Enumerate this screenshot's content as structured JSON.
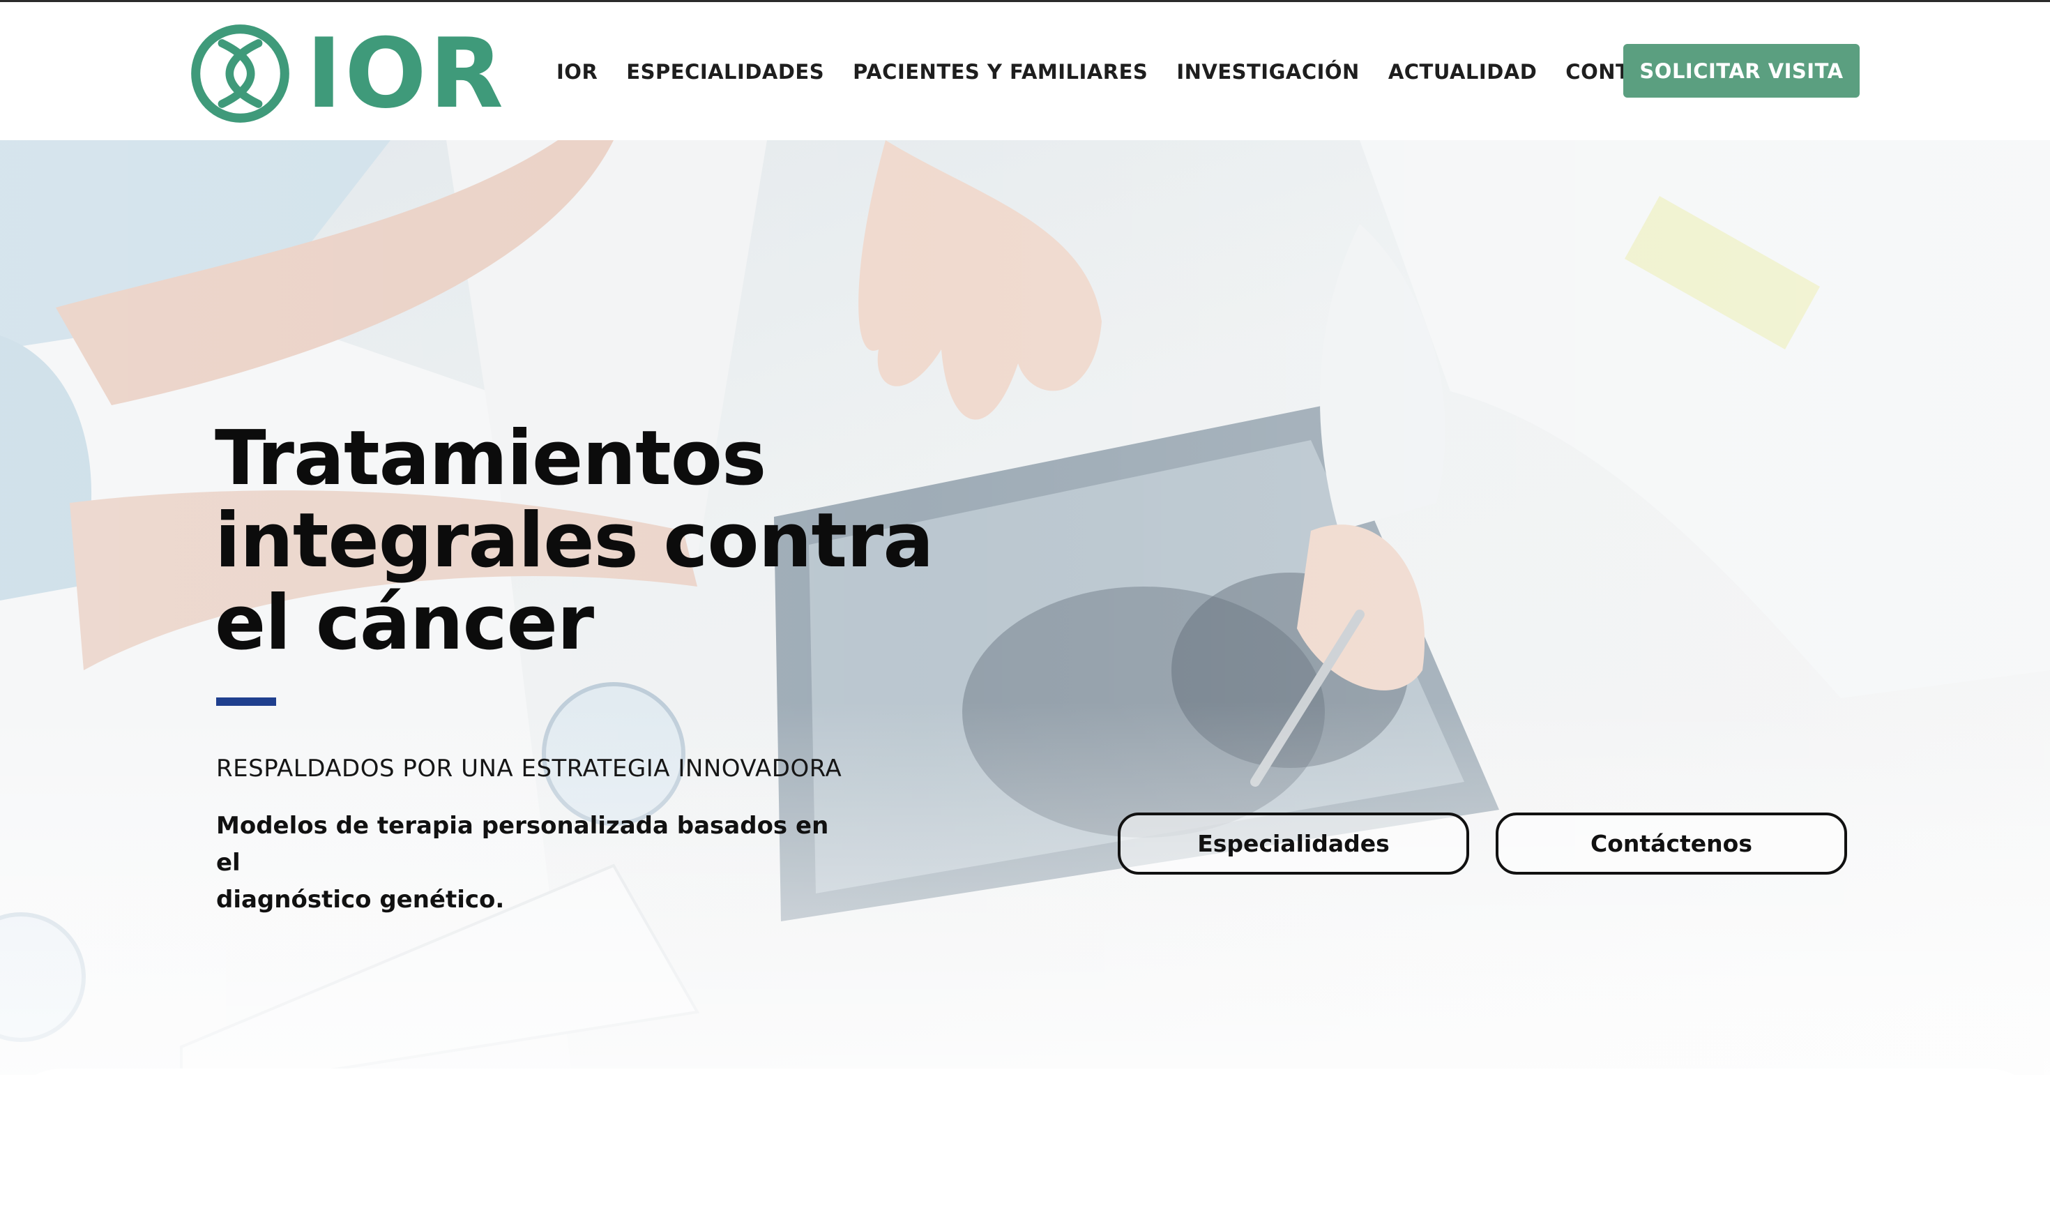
{
  "brand": {
    "name": "IOR",
    "color": "#3f9a7a"
  },
  "nav": {
    "items": [
      {
        "label": "IOR"
      },
      {
        "label": "ESPECIALIDADES"
      },
      {
        "label": "PACIENTES Y FAMILIARES"
      },
      {
        "label": "INVESTIGACIÓN"
      },
      {
        "label": "ACTUALIDAD"
      },
      {
        "label": "CONTACTO"
      }
    ],
    "cta_label": "SOLICITAR VISITA",
    "cta_color": "#5b9f80"
  },
  "hero": {
    "title_lines": [
      "Tratamientos",
      "integrales contra",
      "el cáncer"
    ],
    "kicker": "RESPALDADOS POR UNA ESTRATEGIA INNOVADORA",
    "description_lines": [
      "Modelos de terapia personalizada basados en el",
      "diagnóstico genético."
    ],
    "buttons": [
      {
        "label": "Especialidades"
      },
      {
        "label": "Contáctenos"
      }
    ],
    "accent_color": "#1f3f8e"
  }
}
